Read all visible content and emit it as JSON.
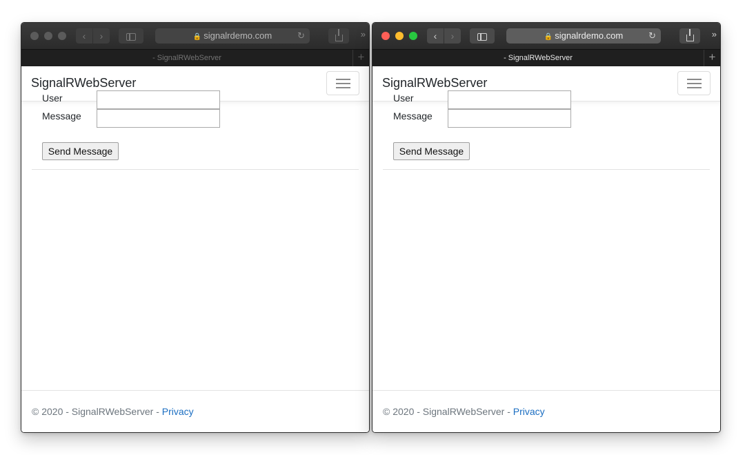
{
  "windows": [
    {
      "id": "left",
      "state": "inactive",
      "url": "signalrdemo.com",
      "tab_title": "- SignalRWebServer"
    },
    {
      "id": "right",
      "state": "active",
      "url": "signalrdemo.com",
      "tab_title": "- SignalRWebServer"
    }
  ],
  "browser": {
    "back_icon": "‹",
    "forward_icon": "›",
    "more_icon": "»",
    "new_tab_icon": "+",
    "lock_icon": "🔒",
    "reload_icon": "↻",
    "traffic_colors": {
      "close": "#fe5f57",
      "minimize": "#febc2e",
      "zoom": "#28c840",
      "inactive": "#5b5b5b"
    }
  },
  "page": {
    "brand": "SignalRWebServer",
    "user_label": "User",
    "message_label": "Message",
    "user_value": "",
    "message_value": "",
    "send_button": "Send Message",
    "footer_prefix": "© 2020 - SignalRWebServer - ",
    "footer_link": "Privacy",
    "link_color": "#1b6ec2"
  }
}
